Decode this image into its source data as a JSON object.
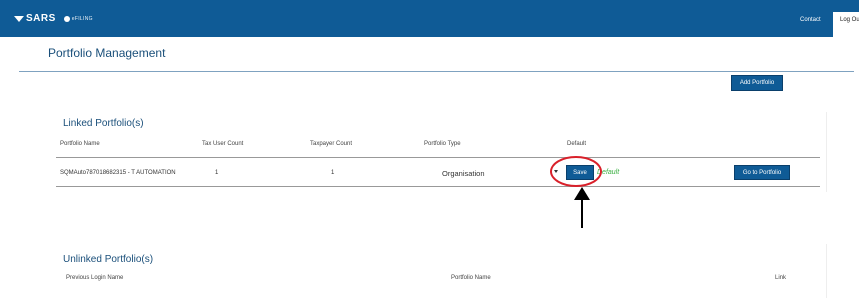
{
  "header": {
    "logo_text": "SARS",
    "logo_sub": "eFILING",
    "nav": {
      "contact": "Contact",
      "logout": "Log Ou"
    }
  },
  "page": {
    "title": "Portfolio Management"
  },
  "toolbar": {
    "add_portfolio": "Add Portfolio"
  },
  "linked": {
    "heading": "Linked Portfolio(s)",
    "columns": [
      "Portfolio Name",
      "Tax User Count",
      "Taxpayer Count",
      "Portfolio Type",
      "Default"
    ],
    "rows": [
      {
        "portfolio_name": "SQMAuto787018682315 - T AUTOMATION",
        "tax_user_count": "1",
        "taxpayer_count": "1",
        "portfolio_type": "Organisation",
        "save_label": "Save",
        "default_label": "Default",
        "goto_label": "Go to Portfolio"
      }
    ]
  },
  "unlinked": {
    "heading": "Unlinked Portfolio(s)",
    "columns": [
      "Previous Login Name",
      "Portfolio Name",
      "Link"
    ]
  },
  "colors": {
    "brand": "#0f5b96",
    "annotation": "#d9202a",
    "default_green": "#3cb043"
  },
  "icons": {
    "logo": "sars-logo-icon",
    "dropdown": "chevron-down-icon",
    "annotation_arrow": "arrow-up-icon"
  }
}
